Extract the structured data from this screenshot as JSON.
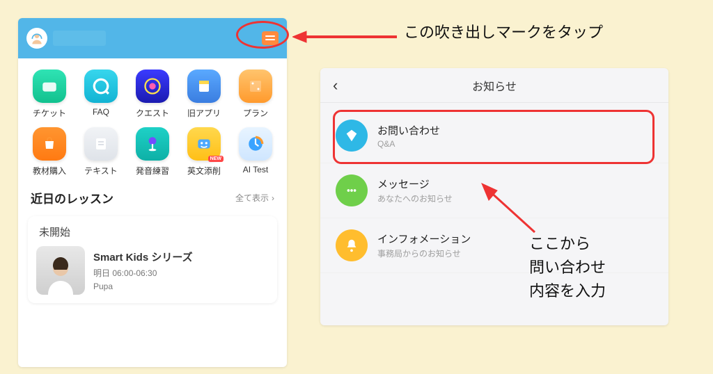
{
  "colors": {
    "header": "#52b6e8",
    "speech": "#ff8a3d",
    "accentRed": "#e33"
  },
  "header": {
    "username_blurred": true
  },
  "icons": [
    {
      "label": "チケット",
      "bg": "linear-gradient(#2fe3b4,#11c18e)"
    },
    {
      "label": "FAQ",
      "bg": "linear-gradient(#37d6ed,#12b3d3)"
    },
    {
      "label": "クエスト",
      "bg": "linear-gradient(#3b3bff,#1b1bb0)"
    },
    {
      "label": "旧アプリ",
      "bg": "linear-gradient(#5aa9ff,#3a7de0)"
    },
    {
      "label": "プラン",
      "bg": "linear-gradient(#ffc46d,#ff9a2d)"
    },
    {
      "label": "教材購入",
      "bg": "linear-gradient(#ff9530,#ff7a12)"
    },
    {
      "label": "テキスト",
      "bg": "linear-gradient(#f1f3f6,#dfe3e9)"
    },
    {
      "label": "発音練習",
      "bg": "linear-gradient(#1ed1c7,#0eb0a6)"
    },
    {
      "label": "英文添削",
      "bg": "linear-gradient(#ffd84d,#ffbf17)",
      "badge": "NEW"
    },
    {
      "label": "AI Test",
      "bg": "linear-gradient(#e8f4ff,#cfe6ff)"
    }
  ],
  "lessons": {
    "title": "近日のレッスン",
    "show_all": "全て表示",
    "status": "未開始",
    "series": "Smart Kids シリーズ",
    "time": "明日 06:00-06:30",
    "tutor": "Pupa"
  },
  "notifications": {
    "title": "お知らせ",
    "items": [
      {
        "title": "お問い合わせ",
        "sub": "Q&A",
        "color": "#2eb8e6",
        "icon": "diamond"
      },
      {
        "title": "メッセージ",
        "sub": "あなたへのお知らせ",
        "color": "#6fcf4a",
        "icon": "dots"
      },
      {
        "title": "インフォメーション",
        "sub": "事務局からのお知らせ",
        "color": "#ffbd2e",
        "icon": "bell"
      }
    ]
  },
  "annotations": {
    "top": "この吹き出しマークをタップ",
    "side": "ここから\n問い合わせ\n内容を入力"
  }
}
